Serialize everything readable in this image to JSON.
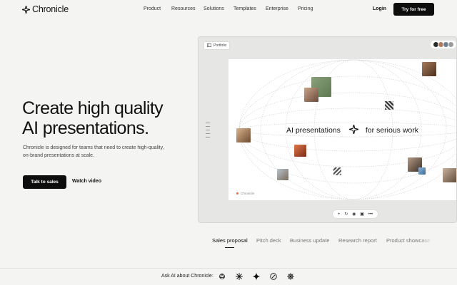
{
  "nav": {
    "brand": "Chronicle",
    "menu": [
      "Product",
      "Resources",
      "Solutions",
      "Templates",
      "Enterprise",
      "Pricing"
    ],
    "login": "Login",
    "cta": "Try for free"
  },
  "hero": {
    "headline_line1": "Create high quality",
    "headline_line2": "AI presentations.",
    "subtitle_line1": "Chronicle is designed for teams that need to create high-quality,",
    "subtitle_line2": "on-brand presentations at scale.",
    "primary_button": "Talk to sales",
    "secondary_button": "Watch video"
  },
  "app_window": {
    "file_name": "Portfolio",
    "slide": {
      "left_text": "AI presentations",
      "right_text": "for serious work",
      "footer_brand": "Chronicle"
    },
    "toolbar_icons": [
      "plus-icon",
      "history-icon",
      "camera-icon",
      "image-icon",
      "more-icon"
    ]
  },
  "tabs": {
    "items": [
      "Sales proposal",
      "Pitch deck",
      "Business update",
      "Research report",
      "Product showcase"
    ],
    "active_index": 0
  },
  "bottom_bar": {
    "label": "Ask AI about Chronicle:",
    "ai_icons": [
      "openai-icon",
      "claude-icon",
      "gemini-icon",
      "perplexity-icon",
      "grok-icon"
    ]
  },
  "colors": {
    "accent_dark": "#0d0d0d",
    "page_background": "#f4f4f3",
    "orange_dot": "#f06a2b"
  }
}
